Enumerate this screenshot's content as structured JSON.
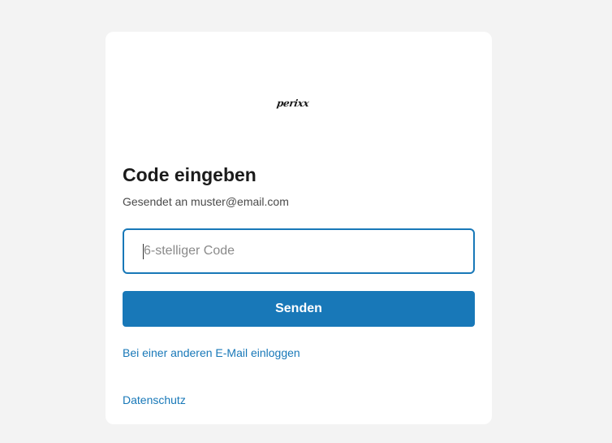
{
  "brand": {
    "logo_text": "perixx"
  },
  "form": {
    "title": "Code eingeben",
    "sent_to": "Gesendet an muster@email.com",
    "code_input": {
      "value": "",
      "placeholder": "6-stelliger Code"
    },
    "submit_label": "Senden"
  },
  "links": {
    "other_email": "Bei einer anderen E-Mail einloggen",
    "privacy": "Datenschutz"
  },
  "colors": {
    "accent": "#1878b8",
    "background": "#f3f3f3",
    "card": "#ffffff"
  }
}
